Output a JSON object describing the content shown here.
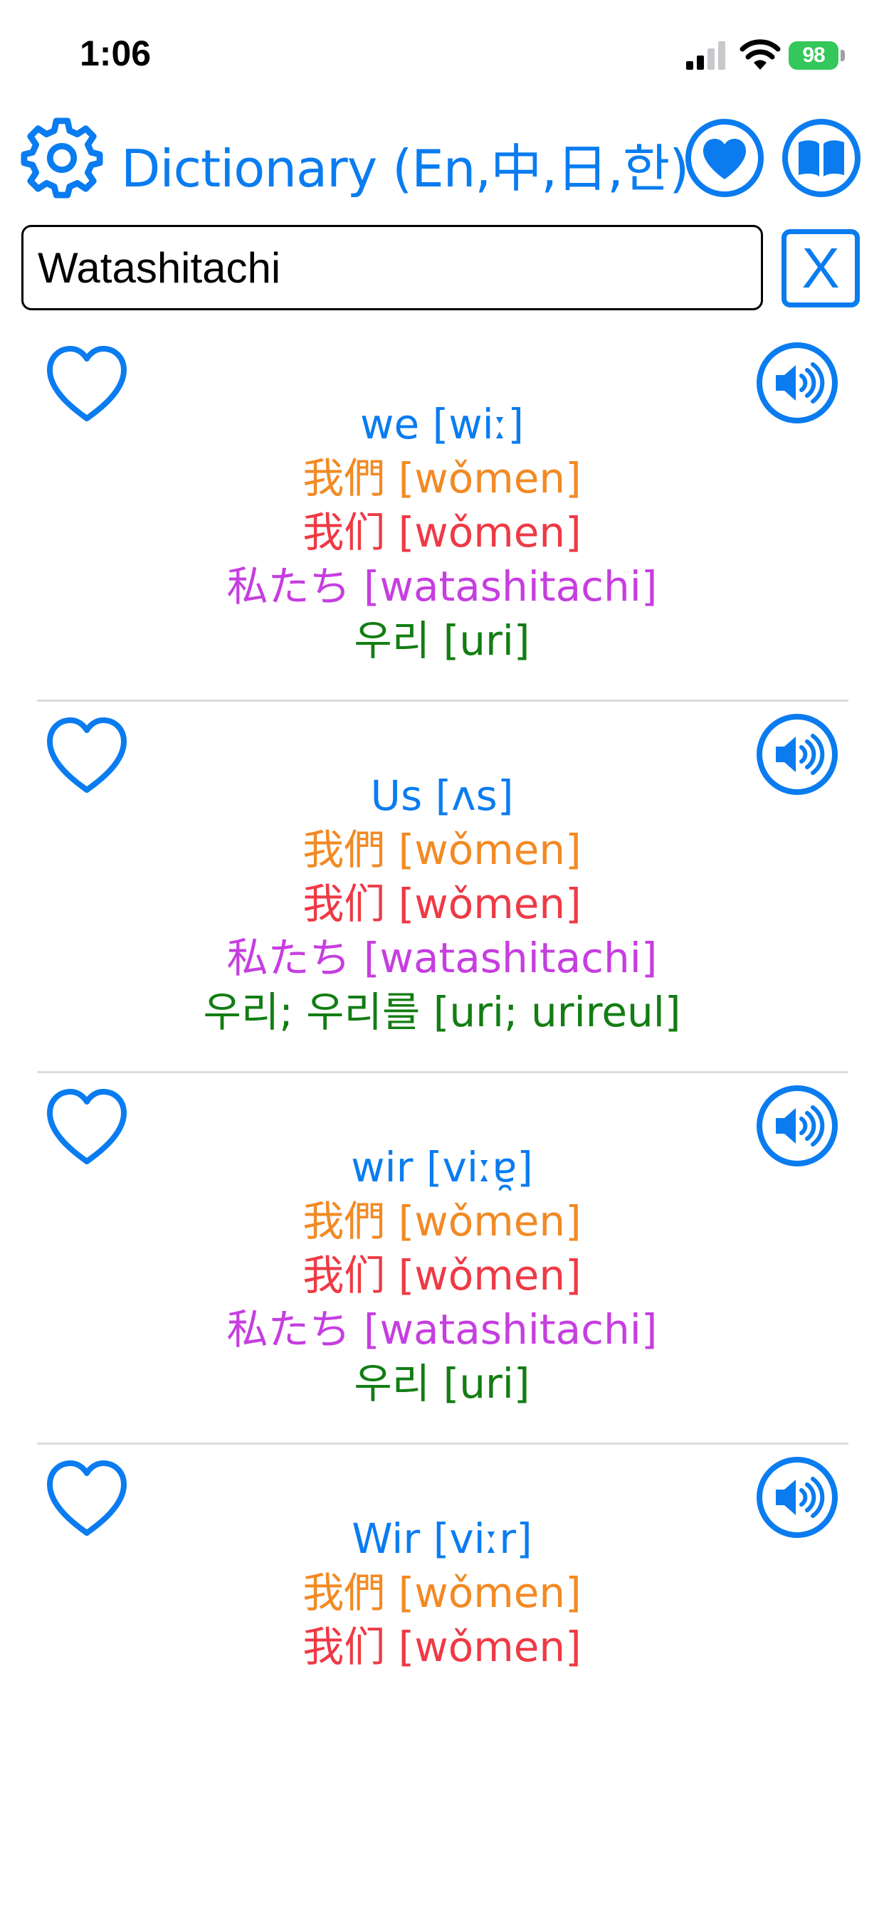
{
  "status_bar": {
    "time": "1:06",
    "battery": "98"
  },
  "header": {
    "title": "Dictionary (En,中,日,한)",
    "icons": [
      "gear-icon",
      "heart-filled-icon",
      "book-icon"
    ]
  },
  "search": {
    "value": "Watashitachi",
    "clear_label": "X"
  },
  "colors": {
    "accent": "#0a7cf0",
    "traditional_chinese": "#f28a24",
    "simplified_chinese": "#ee3a45",
    "japanese": "#c63ee0",
    "korean": "#137d13"
  },
  "results": [
    {
      "en": "we  [wiː]",
      "zh_tw": "我們  [wǒmen]",
      "zh_cn": "我们  [wǒmen]",
      "ja": "私たち  [watashitachi]",
      "ko": "우리  [uri]"
    },
    {
      "en": "Us  [ʌs]",
      "zh_tw": "我們  [wǒmen]",
      "zh_cn": "我们  [wǒmen]",
      "ja": "私たち  [watashitachi]",
      "ko": "우리; 우리를  [uri; urireul]"
    },
    {
      "en": "wir  [viːɐ̯]",
      "zh_tw": "我們  [wǒmen]",
      "zh_cn": "我们  [wǒmen]",
      "ja": "私たち  [watashitachi]",
      "ko": "우리  [uri]"
    },
    {
      "en": "Wir  [viːr]",
      "zh_tw": "我們  [wǒmen]",
      "zh_cn": "我们  [wǒmen]"
    }
  ]
}
